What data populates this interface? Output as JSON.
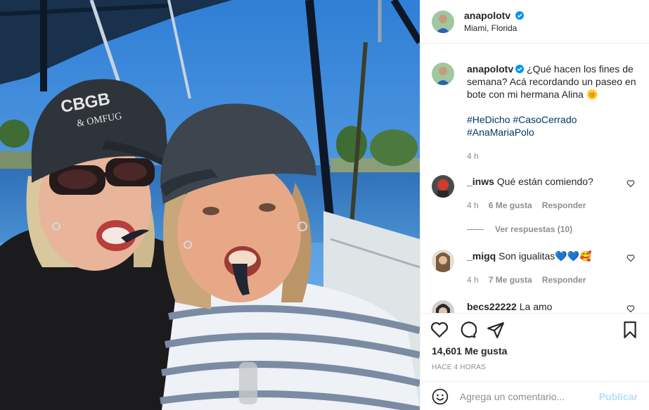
{
  "post": {
    "username": "anapolotv",
    "location": "Miami, Florida"
  },
  "caption": {
    "username": "anapolotv",
    "text": "¿Qué hacen los fines de semana? Acá recordando un paseo en bote con mi hermana Alina 🌞",
    "hashtags": "#HeDicho #CasoCerrado #AnaMariaPolo",
    "time": "4 h"
  },
  "comments": [
    {
      "username": "_inws",
      "text": "Qué están comiendo?",
      "time": "4 h",
      "likes": "6 Me gusta",
      "reply_label": "Responder",
      "view_replies": "Ver respuestas (10)"
    },
    {
      "username": "_migq",
      "text": "Son igualitas💙💙🥰",
      "time": "4 h",
      "likes": "7 Me gusta",
      "reply_label": "Responder"
    },
    {
      "username": "becs22222",
      "text": "La amo"
    }
  ],
  "actions": {
    "likes": "14,601 Me gusta",
    "ago": "HACE 4 HORAS"
  },
  "compose": {
    "placeholder": "Agrega un comentario...",
    "publish_label": "Publicar"
  },
  "icons": {
    "like": "heart-icon",
    "comment": "comment-icon",
    "share": "send-icon",
    "save": "bookmark-icon",
    "emoji": "emoji-icon",
    "verified": "verified-badge-icon"
  },
  "colors": {
    "verified": "#0095f6",
    "hashtag": "#00376b",
    "muted": "#8e8e8e",
    "publish_disabled": "#b2dffc"
  }
}
